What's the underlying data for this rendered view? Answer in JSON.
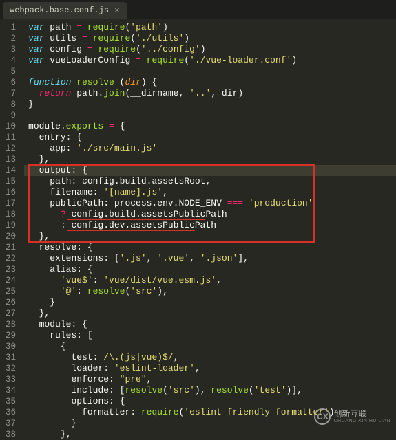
{
  "tab": {
    "filename": "webpack.base.conf.js",
    "close": "×"
  },
  "watermark": {
    "main": "创新互联",
    "sub": "CHUANG XIN HU LIAN",
    "icon": "CX"
  },
  "lines": {
    "l1_var": "var",
    "l1_path": " path ",
    "l1_eq": "=",
    "l1_req": " require",
    "l1_p": "(",
    "l1_s": "'path'",
    "l1_c": ")",
    "l2_var": "var",
    "l2_u": " utils ",
    "l2_eq": "=",
    "l2_req": " require",
    "l2_p": "(",
    "l2_s": "'./utils'",
    "l2_c": ")",
    "l3_var": "var",
    "l3_cf": " config ",
    "l3_eq": "=",
    "l3_req": " require",
    "l3_p": "(",
    "l3_s": "'../config'",
    "l3_c": ")",
    "l4_var": "var",
    "l4_v": " vueLoaderConfig ",
    "l4_eq": "=",
    "l4_req": " require",
    "l4_p": "(",
    "l4_s": "'./vue-loader.conf'",
    "l4_c": ")",
    "l6_fn": "function",
    "l6_sp": " ",
    "l6_name": "resolve",
    "l6_sp2": " ",
    "l6_p": "(",
    "l6_arg": "dir",
    "l6_c": ") {",
    "l7_ind": "  ",
    "l7_ret": "return",
    "l7_a": " path.",
    "l7_join": "join",
    "l7_p": "(__dirname, ",
    "l7_s": "'..'",
    "l7_c": ", dir)",
    "l8": "}",
    "l10_a": "module.",
    "l10_exp": "exports",
    "l10_sp": " ",
    "l10_eq": "=",
    "l10_b": " {",
    "l11_ind": "  ",
    "l11_k": "entry",
    "l11_c": ": {",
    "l12_ind": "    ",
    "l12_k": "app",
    "l12_c": ": ",
    "l12_s": "'./src/main.js'",
    "l13": "  },",
    "l14_ind": "  ",
    "l14_k": "output",
    "l14_c": ": {",
    "l15_ind": "    ",
    "l15_k": "path",
    "l15_c": ": config.build.assetsRoot,",
    "l16_ind": "    ",
    "l16_k": "filename",
    "l16_c": ": ",
    "l16_s": "'[name].js'",
    "l16_cm": ",",
    "l17_ind": "    ",
    "l17_k": "publicPath",
    "l17_c": ": process.env.NODE_ENV ",
    "l17_eq": "===",
    "l17_sp": " ",
    "l17_s": "'production'",
    "l18_ind": "      ",
    "l18_q": "?",
    "l18_t": " config.build.assetsPublicPath",
    "l19_ind": "      ",
    "l19_q": ":",
    "l19_t": " config.dev.assetsPublicPath",
    "l20": "  },",
    "l21_ind": "  ",
    "l21_k": "resolve",
    "l21_c": ": {",
    "l22_ind": "    ",
    "l22_k": "extensions",
    "l22_c": ": [",
    "l22_s1": "'.js'",
    "l22_cm1": ", ",
    "l22_s2": "'.vue'",
    "l22_cm2": ", ",
    "l22_s3": "'.json'",
    "l22_e": "],",
    "l23_ind": "    ",
    "l23_k": "alias",
    "l23_c": ": {",
    "l24_ind": "      ",
    "l24_k": "'vue$'",
    "l24_c": ": ",
    "l24_s": "'vue/dist/vue.esm.js'",
    "l24_cm": ",",
    "l25_ind": "      ",
    "l25_k": "'@'",
    "l25_c": ": ",
    "l25_fn": "resolve",
    "l25_p": "(",
    "l25_s": "'src'",
    "l25_e": "),",
    "l26": "    }",
    "l27": "  },",
    "l28_ind": "  ",
    "l28_k": "module",
    "l28_c": ": {",
    "l29_ind": "    ",
    "l29_k": "rules",
    "l29_c": ": [",
    "l30": "      {",
    "l31_ind": "        ",
    "l31_k": "test",
    "l31_c": ": ",
    "l31_rx": "/\\.(js|vue)$/",
    "l31_cm": ",",
    "l32_ind": "        ",
    "l32_k": "loader",
    "l32_c": ": ",
    "l32_s": "'eslint-loader'",
    "l32_cm": ",",
    "l33_ind": "        ",
    "l33_k": "enforce",
    "l33_c": ": ",
    "l33_s": "\"pre\"",
    "l33_cm": ",",
    "l34_ind": "        ",
    "l34_k": "include",
    "l34_c": ": [",
    "l34_f1": "resolve",
    "l34_p1": "(",
    "l34_s1": "'src'",
    "l34_c1": "), ",
    "l34_f2": "resolve",
    "l34_p2": "(",
    "l34_s2": "'test'",
    "l34_c2": ")],",
    "l35_ind": "        ",
    "l35_k": "options",
    "l35_c": ": {",
    "l36_ind": "          ",
    "l36_k": "formatter",
    "l36_c": ": ",
    "l36_r": "require",
    "l36_p": "(",
    "l36_s": "'eslint-friendly-formatter'",
    "l36_e": ")",
    "l37": "        }",
    "l38": "      },"
  }
}
